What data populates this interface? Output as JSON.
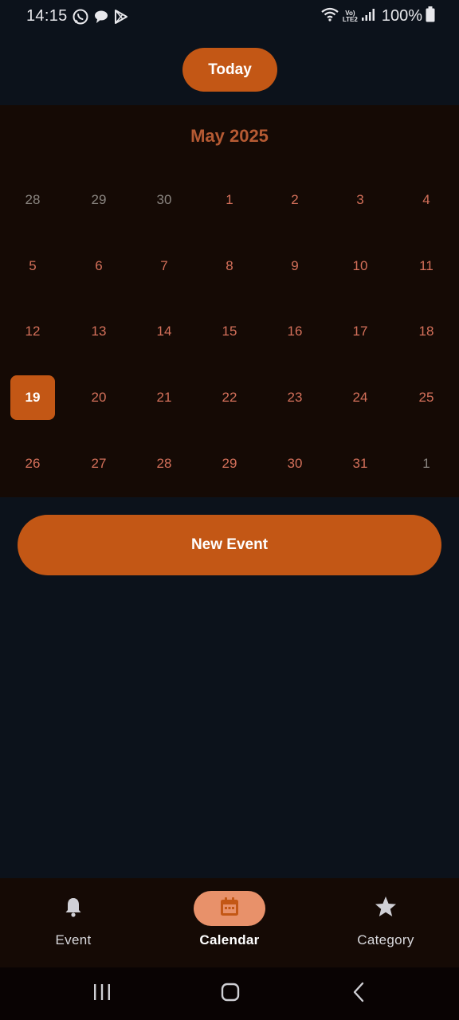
{
  "status_bar": {
    "time": "14:15",
    "apps": [
      "whatsapp-icon",
      "chat-bubble-icon",
      "play-store-icon"
    ],
    "network_label_top": "Vo)",
    "network_label_bottom": "LTE2",
    "battery": "100%"
  },
  "header": {
    "today_label": "Today"
  },
  "calendar": {
    "month_title": "May 2025",
    "selected_day": "19",
    "weeks": [
      [
        {
          "d": "28",
          "m": true
        },
        {
          "d": "29",
          "m": true
        },
        {
          "d": "30",
          "m": true
        },
        {
          "d": "1"
        },
        {
          "d": "2"
        },
        {
          "d": "3"
        },
        {
          "d": "4"
        }
      ],
      [
        {
          "d": "5"
        },
        {
          "d": "6"
        },
        {
          "d": "7"
        },
        {
          "d": "8"
        },
        {
          "d": "9"
        },
        {
          "d": "10"
        },
        {
          "d": "11"
        }
      ],
      [
        {
          "d": "12"
        },
        {
          "d": "13"
        },
        {
          "d": "14"
        },
        {
          "d": "15"
        },
        {
          "d": "16"
        },
        {
          "d": "17"
        },
        {
          "d": "18"
        }
      ],
      [
        {
          "d": "19",
          "s": true
        },
        {
          "d": "20"
        },
        {
          "d": "21"
        },
        {
          "d": "22"
        },
        {
          "d": "23"
        },
        {
          "d": "24"
        },
        {
          "d": "25"
        }
      ],
      [
        {
          "d": "26"
        },
        {
          "d": "27"
        },
        {
          "d": "28"
        },
        {
          "d": "29"
        },
        {
          "d": "30"
        },
        {
          "d": "31"
        },
        {
          "d": "1",
          "m": true
        }
      ]
    ]
  },
  "actions": {
    "new_event_label": "New Event"
  },
  "bottom_nav": {
    "items": [
      {
        "label": "Event",
        "icon": "bell-icon",
        "active": false
      },
      {
        "label": "Calendar",
        "icon": "calendar-icon",
        "active": true
      },
      {
        "label": "Category",
        "icon": "star-icon",
        "active": false
      }
    ]
  },
  "colors": {
    "accent": "#c35715",
    "accent_light": "#e8916a",
    "background": "#0c121b",
    "panel": "#150a05",
    "day_text": "#d4705a",
    "muted_text": "#8a8580"
  }
}
